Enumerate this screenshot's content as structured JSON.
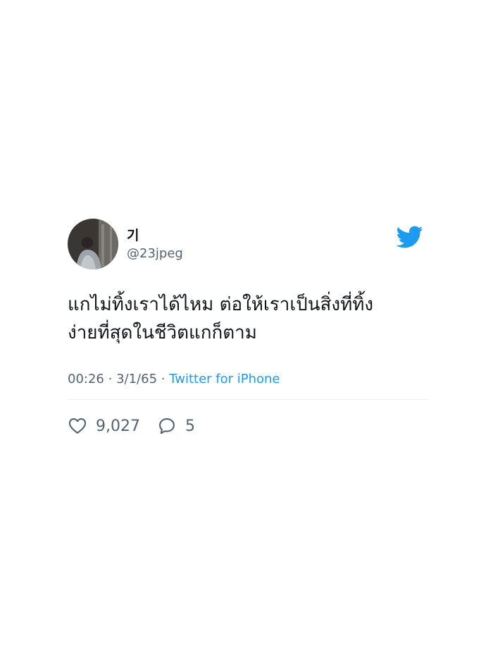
{
  "tweet": {
    "display_name": "기",
    "handle": "@23jpeg",
    "text_line1": "แกไม่ทิ้งเราได้ไหม ต่อให้เราเป็นสิ่งที่ทิ้ง",
    "text_line2": "ง่ายที่สุดในชีวิตแกก็ตาม",
    "time": "00:26",
    "separator": "·",
    "date": "3/1/65",
    "source": "Twitter for iPhone",
    "likes": "9,027",
    "replies": "5"
  },
  "icons": {
    "brand": "twitter-bird-icon",
    "like": "heart-icon",
    "reply": "comment-icon"
  },
  "colors": {
    "brand": "#1d9bf0",
    "text": "#0f1419",
    "secondary": "#536471"
  }
}
